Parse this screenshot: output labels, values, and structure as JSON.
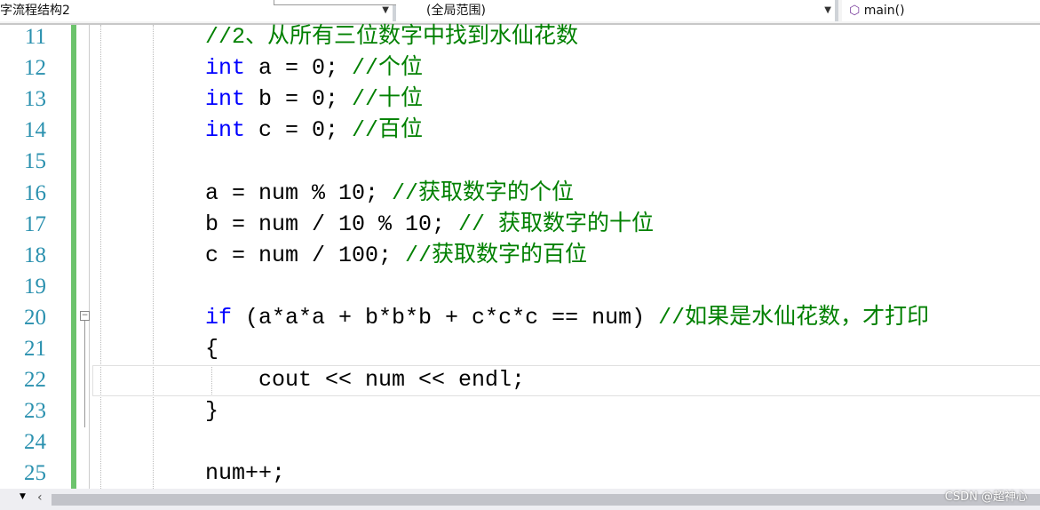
{
  "navbar": {
    "project": "字流程结构2",
    "scope": "(全局范围)",
    "function": "main()",
    "function_icon": "function-cube-icon"
  },
  "current_line": 22,
  "lines": [
    {
      "n": "11",
      "tokens": [
        {
          "t": "//2、从所有三位数字中找到水仙花数",
          "c": "cm"
        }
      ]
    },
    {
      "n": "12",
      "tokens": [
        {
          "t": "int",
          "c": "kw"
        },
        {
          "t": " a = 0; ",
          "c": ""
        },
        {
          "t": "//个位",
          "c": "cm"
        }
      ]
    },
    {
      "n": "13",
      "tokens": [
        {
          "t": "int",
          "c": "kw"
        },
        {
          "t": " b = 0; ",
          "c": ""
        },
        {
          "t": "//十位",
          "c": "cm"
        }
      ]
    },
    {
      "n": "14",
      "tokens": [
        {
          "t": "int",
          "c": "kw"
        },
        {
          "t": " c = 0; ",
          "c": ""
        },
        {
          "t": "//百位",
          "c": "cm"
        }
      ]
    },
    {
      "n": "15",
      "tokens": []
    },
    {
      "n": "16",
      "tokens": [
        {
          "t": "a = num % 10; ",
          "c": ""
        },
        {
          "t": "//获取数字的个位",
          "c": "cm"
        }
      ]
    },
    {
      "n": "17",
      "tokens": [
        {
          "t": "b = num / 10 % 10; ",
          "c": ""
        },
        {
          "t": "// 获取数字的十位",
          "c": "cm"
        }
      ]
    },
    {
      "n": "18",
      "tokens": [
        {
          "t": "c = num / 100; ",
          "c": ""
        },
        {
          "t": "//获取数字的百位",
          "c": "cm"
        }
      ]
    },
    {
      "n": "19",
      "tokens": []
    },
    {
      "n": "20",
      "tokens": [
        {
          "t": "if",
          "c": "kw"
        },
        {
          "t": " (a*a*a + b*b*b + c*c*c == num) ",
          "c": ""
        },
        {
          "t": "//如果是水仙花数，才打印",
          "c": "cm"
        }
      ]
    },
    {
      "n": "21",
      "tokens": [
        {
          "t": "{",
          "c": ""
        }
      ]
    },
    {
      "n": "22",
      "tokens": [
        {
          "t": "    cout << num << endl;",
          "c": ""
        }
      ]
    },
    {
      "n": "23",
      "tokens": [
        {
          "t": "}",
          "c": ""
        }
      ]
    },
    {
      "n": "24",
      "tokens": []
    },
    {
      "n": "25",
      "tokens": [
        {
          "t": "num++;",
          "c": ""
        }
      ]
    }
  ],
  "watermark": "CSDN @超神心"
}
